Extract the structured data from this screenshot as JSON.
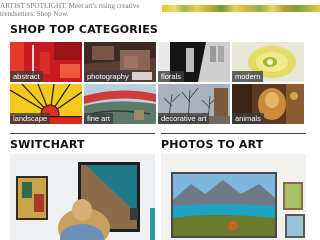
{
  "spotlight": {
    "text": "ARTIST SPOTLIGHT. Meet art's rising creative trendsetters. Shop Now."
  },
  "sections": {
    "shop_top_categories": "SHOP TOP CATEGORIES",
    "switchart": "SWITCHART",
    "photos_to_art": "PHOTOS TO ART"
  },
  "categories": [
    {
      "label": "abstract"
    },
    {
      "label": "photography"
    },
    {
      "label": "florals"
    },
    {
      "label": "modern"
    },
    {
      "label": "landscape"
    },
    {
      "label": "fine art"
    },
    {
      "label": "decorative art"
    },
    {
      "label": "animals"
    }
  ],
  "colors": {
    "text": "#111111",
    "spotlight_text": "#777777",
    "label_overlay": "#3c3c3c",
    "rule": "#444444"
  }
}
